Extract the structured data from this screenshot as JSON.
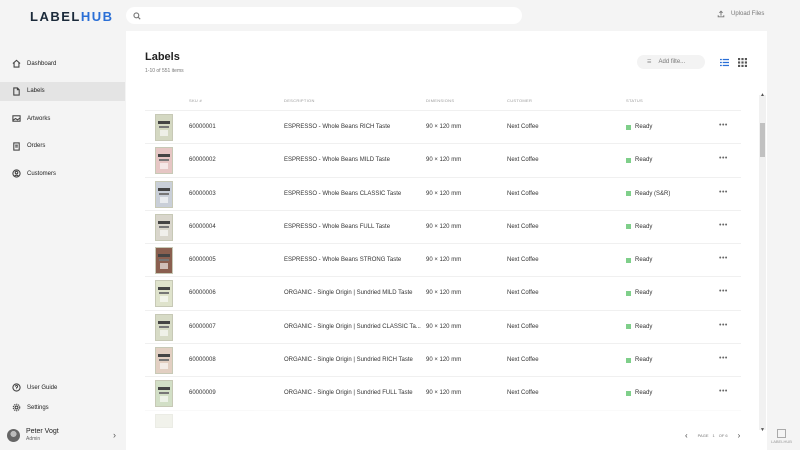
{
  "app": {
    "logo_a": "LABEL",
    "logo_b": "HUB"
  },
  "search": {
    "placeholder": ""
  },
  "upload": {
    "label": "Upload Files"
  },
  "sidebar": {
    "items": [
      {
        "label": "Dashboard",
        "icon": "home-icon"
      },
      {
        "label": "Labels",
        "icon": "file-icon",
        "active": true
      },
      {
        "label": "Artworks",
        "icon": "image-icon"
      },
      {
        "label": "Orders",
        "icon": "orders-icon"
      },
      {
        "label": "Customers",
        "icon": "user-icon"
      }
    ],
    "bottom": [
      {
        "label": "User Guide",
        "icon": "help-icon"
      },
      {
        "label": "Settings",
        "icon": "gear-icon"
      }
    ],
    "user": {
      "name": "Peter Vogt",
      "role": "Admin"
    }
  },
  "main": {
    "title": "Labels",
    "subtitle": "1-10 of 551 items",
    "filter_placeholder": "Add filte...",
    "columns": {
      "sku": "SKU #",
      "description": "DESCRIPTION",
      "dimensions": "DIMENSIONS",
      "customer": "CUSTOMER",
      "status": "STATUS"
    },
    "rows": [
      {
        "sku": "60000001",
        "description": "ESPRESSO - Whole Beans RICH Taste",
        "dimensions": "90 × 120 mm",
        "customer": "Next Coffee",
        "status": "Ready",
        "thumb_color": "#d4d8c2"
      },
      {
        "sku": "60000002",
        "description": "ESPRESSO - Whole Beans MILD Taste",
        "dimensions": "90 × 120 mm",
        "customer": "Next Coffee",
        "status": "Ready",
        "thumb_color": "#e6c6c4"
      },
      {
        "sku": "60000003",
        "description": "ESPRESSO - Whole Beans CLASSIC Taste",
        "dimensions": "90 × 120 mm",
        "customer": "Next Coffee",
        "status": "Ready (S&R)",
        "thumb_color": "#c9cfd8"
      },
      {
        "sku": "60000004",
        "description": "ESPRESSO - Whole Beans FULL Taste",
        "dimensions": "90 × 120 mm",
        "customer": "Next Coffee",
        "status": "Ready",
        "thumb_color": "#d9d6cc"
      },
      {
        "sku": "60000005",
        "description": "ESPRESSO - Whole Beans STRONG Taste",
        "dimensions": "90 × 120 mm",
        "customer": "Next Coffee",
        "status": "Ready",
        "thumb_color": "#8a5f4f"
      },
      {
        "sku": "60000006",
        "description": "ORGANIC - Single Origin | Sundried MILD Taste",
        "dimensions": "90 × 120 mm",
        "customer": "Next Coffee",
        "status": "Ready",
        "thumb_color": "#dfe3cc"
      },
      {
        "sku": "60000007",
        "description": "ORGANIC - Single Origin | Sundried CLASSIC Ta...",
        "dimensions": "90 × 120 mm",
        "customer": "Next Coffee",
        "status": "Ready",
        "thumb_color": "#d7dbc6"
      },
      {
        "sku": "60000008",
        "description": "ORGANIC - Single Origin | Sundried RICH Taste",
        "dimensions": "90 × 120 mm",
        "customer": "Next Coffee",
        "status": "Ready",
        "thumb_color": "#e2cfc2"
      },
      {
        "sku": "60000009",
        "description": "ORGANIC - Single Origin | Sundried FULL Taste",
        "dimensions": "90 × 120 mm",
        "customer": "Next Coffee",
        "status": "Ready",
        "thumb_color": "#d2dfc6"
      }
    ],
    "status_color": "#7fcf8a",
    "pager": {
      "page_label": "PAGE",
      "page": "1",
      "of_label": "OF 6"
    }
  },
  "corner": {
    "label": "LABELHUB"
  },
  "colors": {
    "accent": "#2a6fd6",
    "status_ready": "#7fcf8a"
  }
}
